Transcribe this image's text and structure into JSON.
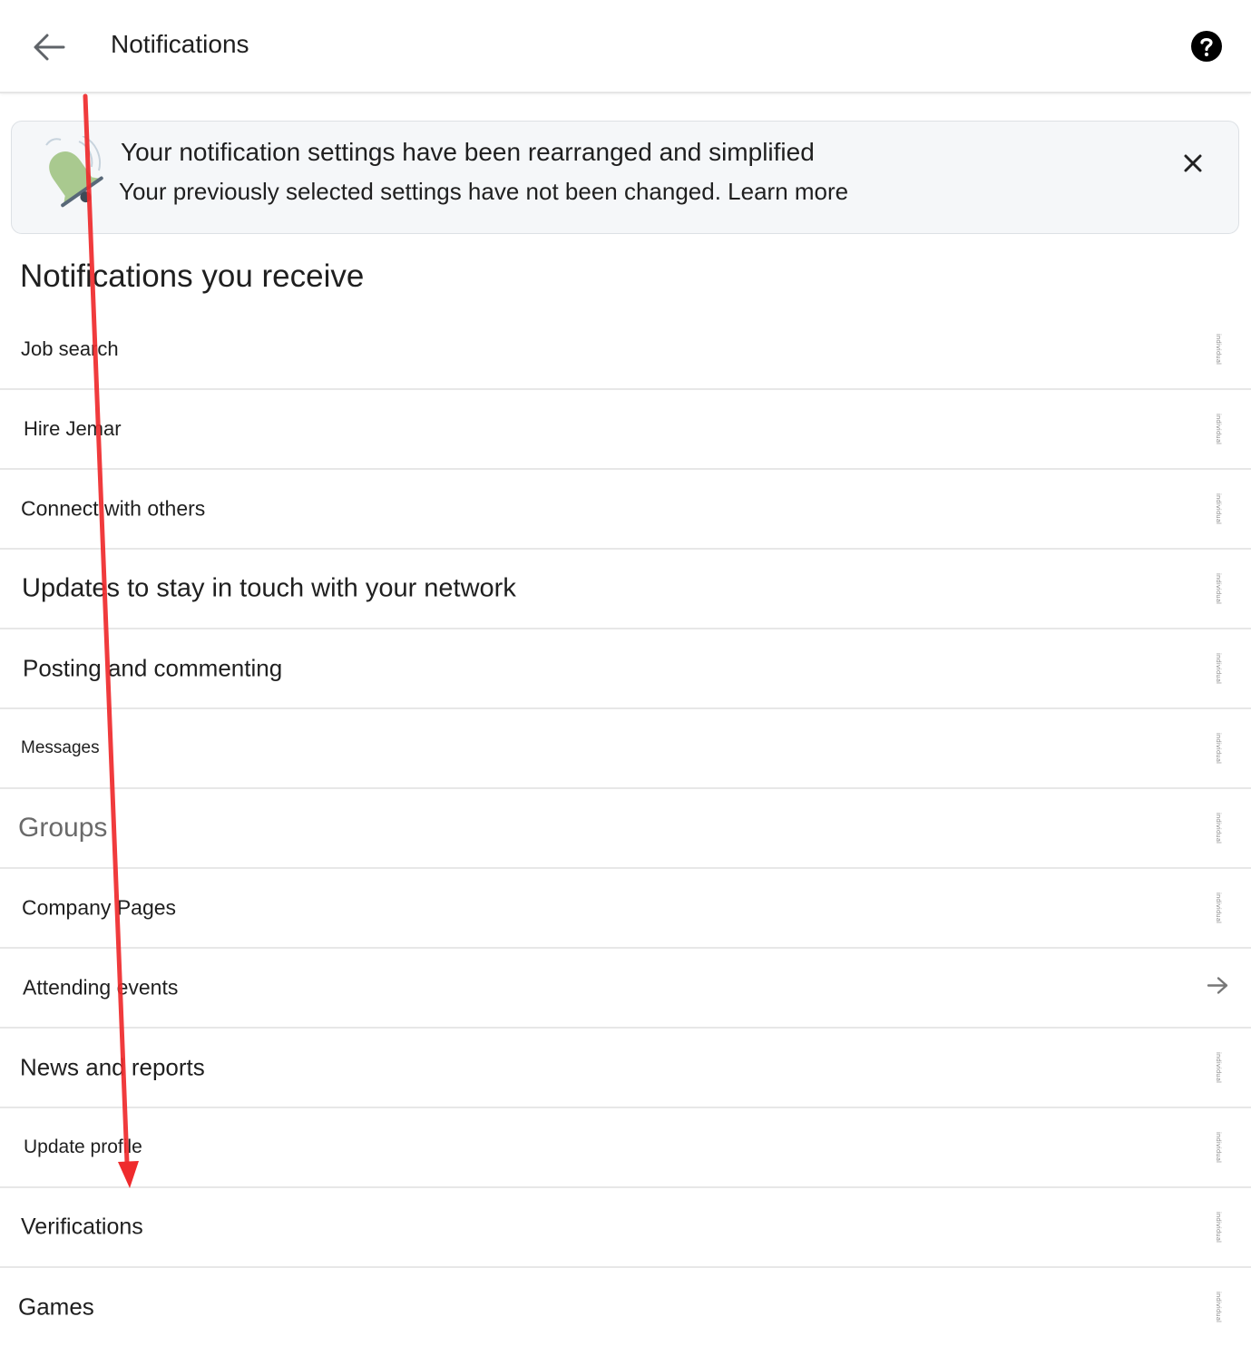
{
  "header": {
    "title": "Notifications",
    "back_icon": "arrow-left-icon",
    "help_icon": "question-circle-icon"
  },
  "banner": {
    "icon": "bell-icon",
    "title": "Your notification settings have been rearranged and simplified",
    "subtitle": "Your previously selected settings have not been changed. Learn more",
    "close_icon": "close-icon"
  },
  "section": {
    "title": "Notifications you receive"
  },
  "rows": [
    {
      "label": "Job search",
      "icon_text": "individual"
    },
    {
      "label": "Hire Jemar",
      "icon_text": "individual"
    },
    {
      "label": "Connect with others",
      "icon_text": "individual"
    },
    {
      "label": "Updates to stay in touch with your network",
      "icon_text": "individual"
    },
    {
      "label": "Posting and commenting",
      "icon_text": "individual"
    },
    {
      "label": "Messages",
      "icon_text": "individual"
    },
    {
      "label": "Groups",
      "icon_text": "individual"
    },
    {
      "label": "Company Pages",
      "icon_text": "individual"
    },
    {
      "label": "Attending events",
      "icon": "arrow-right-icon"
    },
    {
      "label": "News and reports",
      "icon_text": "individual"
    },
    {
      "label": "Update profile",
      "icon_text": "individual"
    },
    {
      "label": "Verifications",
      "icon_text": "individual"
    },
    {
      "label": "Games",
      "icon_text": "individual"
    }
  ],
  "colors": {
    "annotation_arrow": "#ef2b2d",
    "bell": "#a9c98f",
    "groups_label": "#6a6a6a"
  }
}
